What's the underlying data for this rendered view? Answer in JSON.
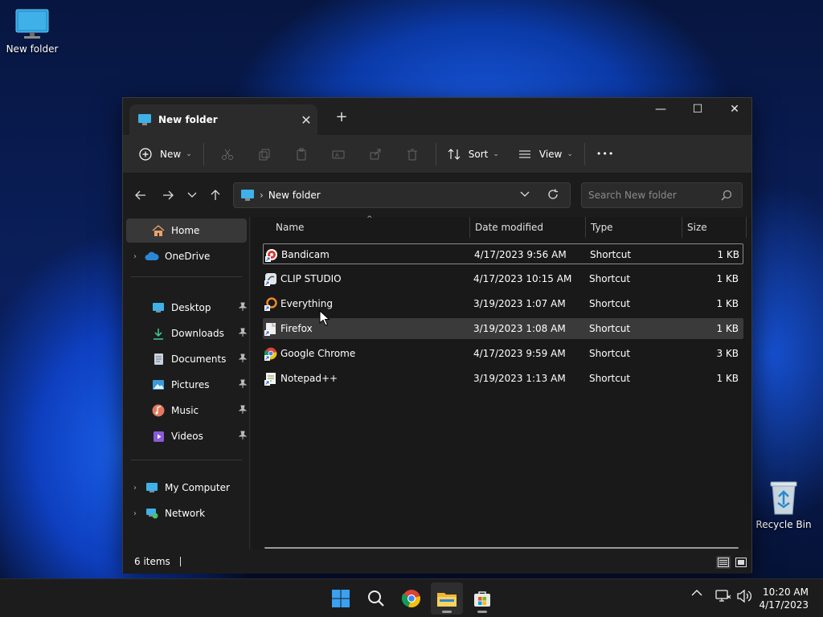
{
  "desktop": {
    "icons": [
      {
        "label": "New folder"
      },
      {
        "label": "Recycle Bin"
      }
    ]
  },
  "window": {
    "tab_title": "New folder",
    "tab_close": "✕",
    "new_tab": "+",
    "minimize": "—",
    "maximize": "☐",
    "close": "✕"
  },
  "toolbar": {
    "new_label": "New",
    "sort_label": "Sort",
    "view_label": "View",
    "more_label": "•••"
  },
  "address": {
    "crumb": "New folder",
    "search_placeholder": "Search New folder"
  },
  "sidebar": {
    "items": [
      {
        "label": "Home",
        "icon": "home-icon"
      },
      {
        "label": "OneDrive",
        "icon": "cloud-icon"
      },
      {
        "label": "Desktop",
        "icon": "desktop-icon"
      },
      {
        "label": "Downloads",
        "icon": "download-icon"
      },
      {
        "label": "Documents",
        "icon": "document-icon"
      },
      {
        "label": "Pictures",
        "icon": "picture-icon"
      },
      {
        "label": "Music",
        "icon": "music-icon"
      },
      {
        "label": "Videos",
        "icon": "video-icon"
      },
      {
        "label": "My Computer",
        "icon": "computer-icon"
      },
      {
        "label": "Network",
        "icon": "network-icon"
      }
    ]
  },
  "file_list": {
    "columns": [
      "Name",
      "Date modified",
      "Type",
      "Size"
    ],
    "rows": [
      {
        "name": "Bandicam",
        "date": "4/17/2023 9:56 AM",
        "type": "Shortcut",
        "size": "1 KB",
        "icon": "bandicam-icon"
      },
      {
        "name": "CLIP STUDIO",
        "date": "4/17/2023 10:15 AM",
        "type": "Shortcut",
        "size": "1 KB",
        "icon": "clip-studio-icon"
      },
      {
        "name": "Everything",
        "date": "3/19/2023 1:07 AM",
        "type": "Shortcut",
        "size": "1 KB",
        "icon": "everything-icon"
      },
      {
        "name": "Firefox",
        "date": "3/19/2023 1:08 AM",
        "type": "Shortcut",
        "size": "1 KB",
        "icon": "firefox-icon"
      },
      {
        "name": "Google Chrome",
        "date": "4/17/2023 9:59 AM",
        "type": "Shortcut",
        "size": "3 KB",
        "icon": "chrome-icon"
      },
      {
        "name": "Notepad++",
        "date": "3/19/2023 1:13 AM",
        "type": "Shortcut",
        "size": "1 KB",
        "icon": "notepad-icon"
      }
    ]
  },
  "status": {
    "item_count": "6 items"
  },
  "taskbar": {
    "time": "10:20 AM",
    "date": "4/17/2023"
  },
  "colors": {
    "accent": "#0078d4",
    "window_bg": "#1c1c1c",
    "toolbar_bg": "#2b2b2b"
  }
}
